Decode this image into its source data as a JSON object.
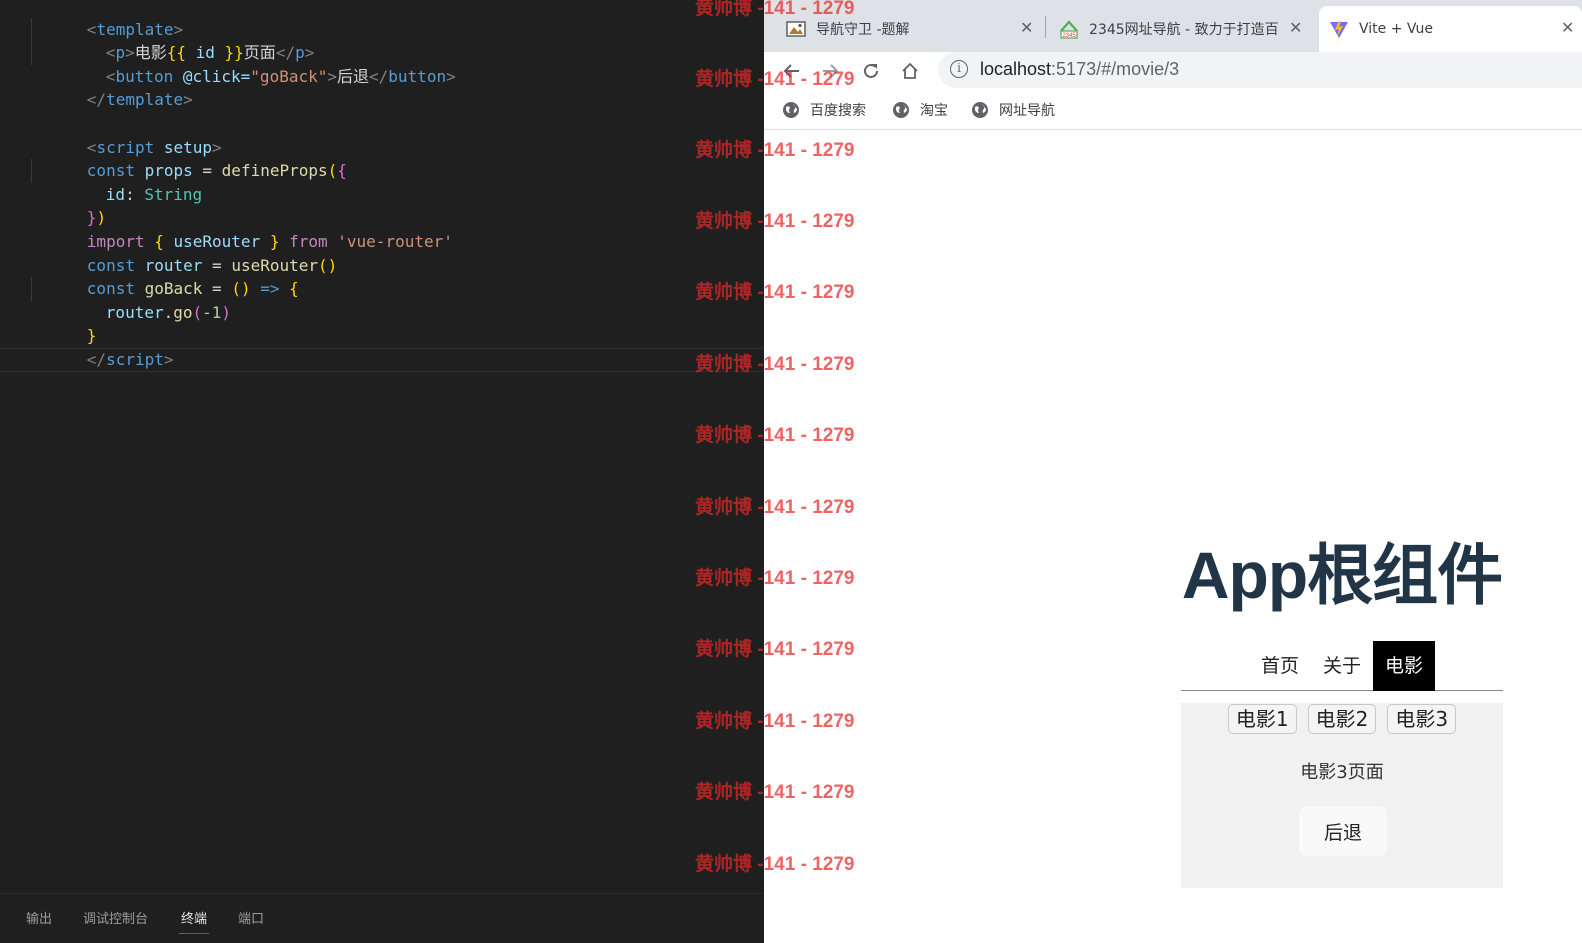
{
  "editor": {
    "lines": [
      [
        "<",
        "template",
        ">"
      ],
      [
        "<",
        "p",
        ">",
        "电影",
        "{{",
        " id ",
        "}}",
        "页面",
        "</",
        "p",
        ">"
      ],
      [
        "<",
        "button",
        " @click=",
        "\"goBack\"",
        ">",
        "后退",
        "</",
        "button",
        ">"
      ],
      [
        "</",
        "template",
        ">"
      ],
      [],
      [
        "<",
        "script",
        " setup",
        ">"
      ],
      [
        "const",
        " props",
        " = ",
        "defineProps",
        "(",
        "{"
      ],
      [
        "id",
        ": ",
        "String"
      ],
      [
        "}",
        ")"
      ],
      [
        "import",
        " { ",
        "useRouter",
        " } ",
        "from",
        " 'vue-router'"
      ],
      [
        "const",
        " router",
        " = ",
        "useRouter",
        "()"
      ],
      [
        "const",
        " goBack",
        " = ",
        "()",
        " => ",
        "{"
      ],
      [
        "router",
        ".",
        "go",
        "(",
        "-1",
        ")"
      ],
      [
        "}"
      ],
      [
        "</",
        "script",
        ">"
      ]
    ],
    "panel_tabs": [
      "输出",
      "调试控制台",
      "终端",
      "端口"
    ],
    "active_panel_tab": "终端"
  },
  "browser": {
    "tabs": [
      {
        "title": "导航守卫 -题解",
        "icon": "image-favicon-icon"
      },
      {
        "title": "2345网址导航 - 致力于打造百",
        "icon": "2345-favicon-icon"
      },
      {
        "title": "Vite + Vue",
        "icon": "vite-favicon-icon"
      }
    ],
    "url_host": "localhost",
    "url_path": ":5173/#/movie/3",
    "bookmarks": [
      "百度搜索",
      "淘宝",
      "网址导航"
    ]
  },
  "page": {
    "title": "App根组件",
    "nav": [
      "首页",
      "关于",
      "电影"
    ],
    "active_nav": "电影",
    "movie_links": [
      "电影1",
      "电影2",
      "电影3"
    ],
    "movie_text": "电影3页面",
    "back_label": "后退"
  },
  "watermark": "黄帅博 -141 - 1279",
  "colors": {
    "editor_bg": "#1f1f1f",
    "watermark": "#e82828",
    "title": "#213547",
    "active_nav_bg": "#000000"
  }
}
